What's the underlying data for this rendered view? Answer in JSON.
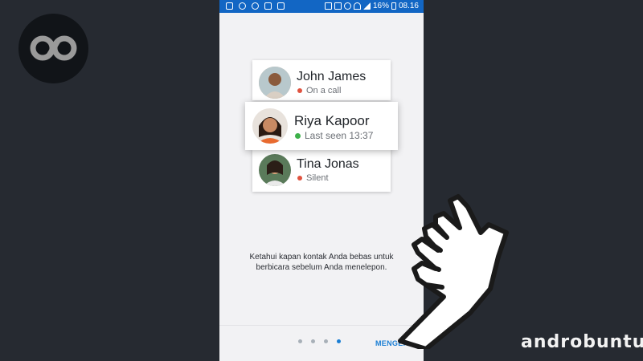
{
  "status_bar": {
    "battery": "16%",
    "time": "08.16"
  },
  "contacts": [
    {
      "name": "John James",
      "status": "On a call",
      "status_color": "#e0523f"
    },
    {
      "name": "Riya Kapoor",
      "status": "Last seen 13:37",
      "status_color": "#3db14a"
    },
    {
      "name": "Tina Jonas",
      "status": "Silent",
      "status_color": "#e0523f"
    }
  ],
  "caption": {
    "line1": "Ketahui kapan kontak Anda bebas untuk",
    "line2": "berbicara sebelum Anda menelepon."
  },
  "pager": {
    "count": 4,
    "active_index": 3
  },
  "next_label": "MENGERTI",
  "brand": "androbuntu",
  "colors": {
    "status_bar": "#1266c4",
    "accent": "#1a7ed4",
    "background": "#262a31"
  }
}
